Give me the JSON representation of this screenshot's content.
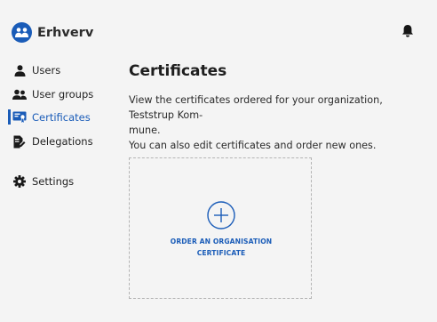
{
  "brand": {
    "name": "Erhverv",
    "color": "#1a5cb8"
  },
  "header": {
    "notification_icon": "bell-icon"
  },
  "sidebar": {
    "items": [
      {
        "label": "Users",
        "icon": "user-icon"
      },
      {
        "label": "User groups",
        "icon": "user-group-icon"
      },
      {
        "label": "Certificates",
        "icon": "certificate-icon",
        "active": true
      },
      {
        "label": "Delegations",
        "icon": "delegation-icon"
      },
      {
        "label": "Settings",
        "icon": "gear-icon"
      }
    ]
  },
  "main": {
    "title": "Certificates",
    "description_line1": "View the certificates ordered for your organization, Teststrup Kom-",
    "description_line2": "mune.",
    "description_line3": "You can also edit certificates and order new ones.",
    "order_card": {
      "line1": "ORDER AN ORGANISATION",
      "line2": "CERTIFICATE",
      "icon": "plus-circle-icon"
    }
  }
}
